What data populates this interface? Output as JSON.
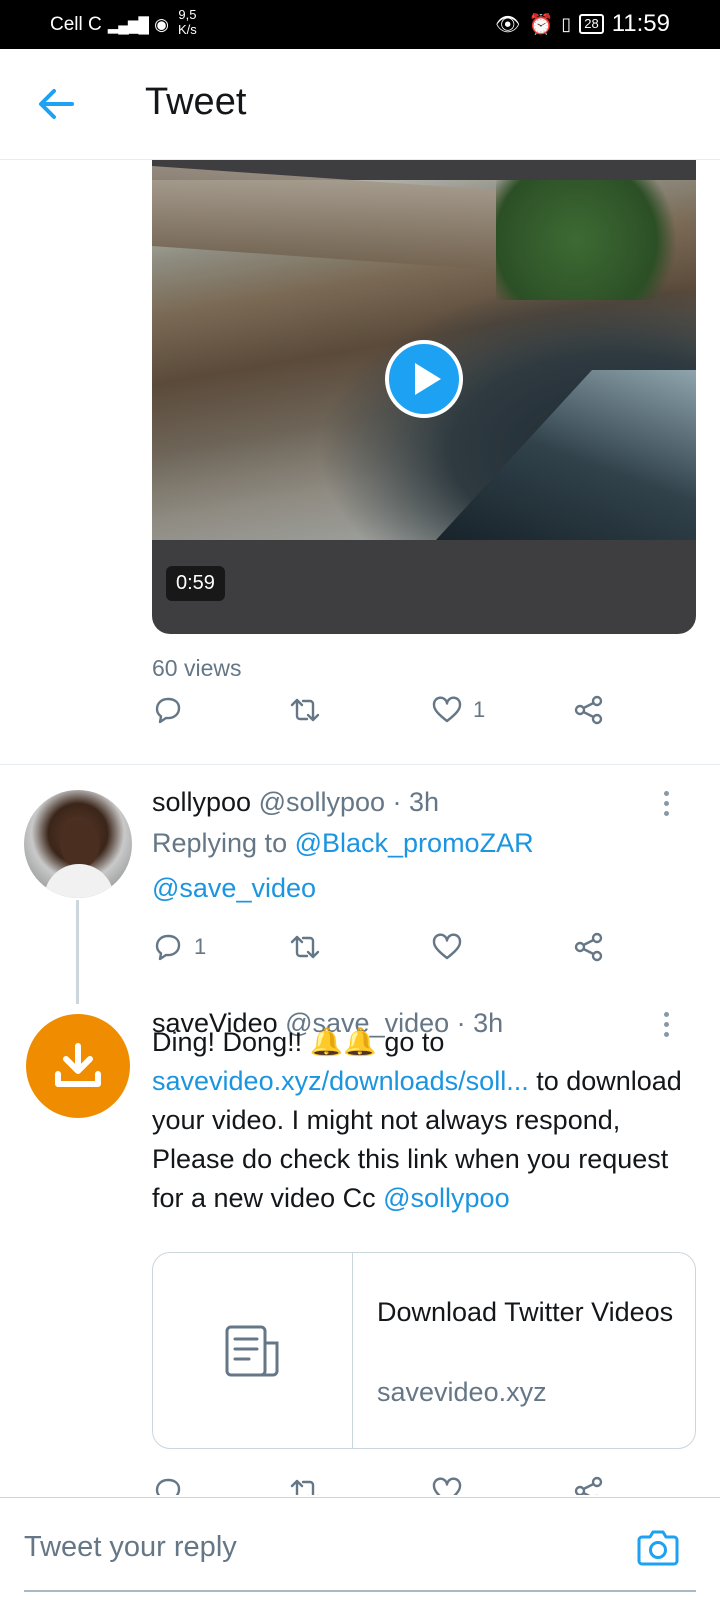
{
  "status_bar": {
    "carrier": "Cell C",
    "speed_value": "9,5",
    "speed_unit": "K/s",
    "battery": "28",
    "time": "11:59"
  },
  "header": {
    "title": "Tweet"
  },
  "video": {
    "duration": "0:59",
    "views": "60 views"
  },
  "main_actions": {
    "like_count": "1"
  },
  "reply1": {
    "name": "sollypoo",
    "handle_time": "@sollypoo · 3h",
    "replying_prefix": "Replying to ",
    "replying_to": "@Black_promoZAR",
    "mention": "@save_video",
    "reply_count": "1"
  },
  "reply2": {
    "name": "saveVideo",
    "handle_time": "@save_video · 3h",
    "body_prefix": "Ding! Dong!! 🔔🔔 go to ",
    "body_link": "savevideo.xyz/downloads/soll...",
    "body_suffix": " to download your video. I might not always respond, Please do check this link when you request for a new video Cc ",
    "body_mention": "@sollypoo",
    "card_title": "Download Twitter Videos",
    "card_domain": "savevideo.xyz"
  },
  "reply_bar": {
    "placeholder": "Tweet your reply"
  },
  "colors": {
    "accent": "#1da1f2",
    "link": "#1b95e0",
    "muted": "#657786",
    "savevideo_orange": "#f08c00"
  },
  "icons": [
    "back-arrow-icon",
    "play-icon",
    "reply-icon",
    "retweet-icon",
    "like-icon",
    "share-icon",
    "more-icon",
    "download-icon",
    "document-icon",
    "camera-icon"
  ]
}
